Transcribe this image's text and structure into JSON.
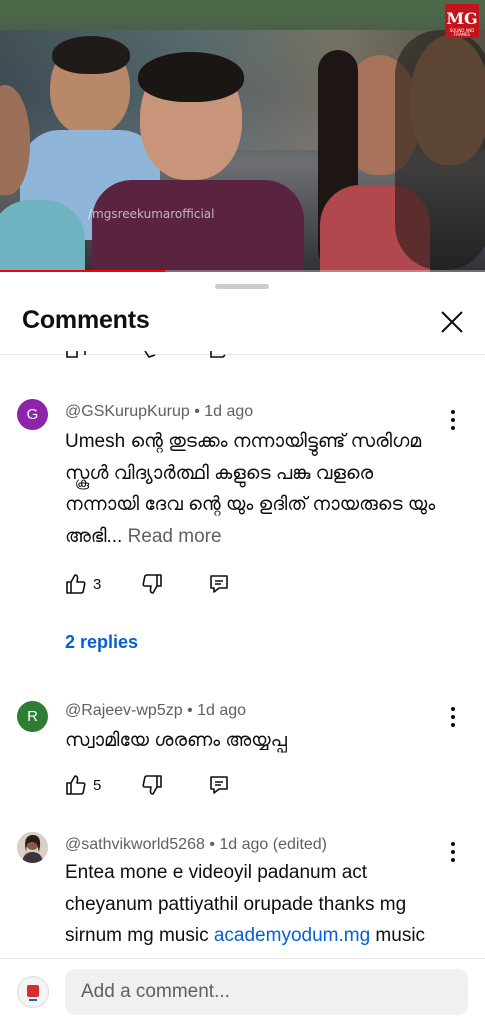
{
  "video": {
    "watermark": "/mgsreekumarofficial",
    "logo": "MG",
    "logo_tag": "SOUND AND FRAMES",
    "progress_fraction": 0.34
  },
  "sheet": {
    "title": "Comments"
  },
  "comments": [
    {
      "avatar_letter": "G",
      "avatar_color": "#8e24aa",
      "author": "@GSKurupKurup",
      "time": "1d ago",
      "text": "Umesh ന്റെ തുടക്കം നന്നായിട്ടുണ്ട് സരിഗമ സ്കൂൾ വിദ്യാർത്ഥി കളുടെ പങ്കു വളരെ നന്നായി ദേവ ന്റെ യും ഉദിത് നായരുടെ യും അഭി...",
      "read_more": "Read more",
      "likes": "3",
      "replies": "2 replies"
    },
    {
      "avatar_letter": "R",
      "avatar_color": "#2e7d32",
      "author": "@Rajeev-wp5zp",
      "time": "1d ago",
      "text": "സ്വാമിയേ ശരണം അയ്യപ്പ",
      "likes": "5"
    },
    {
      "author": "@sathvikworld5268",
      "time": "1d ago (edited)",
      "text_before": "Entea mone e videoyil padanum act cheyanum pattiyathil orupade thanks mg sirnum mg music ",
      "link": "academyodum.mg",
      "text_after": " music"
    }
  ],
  "footer": {
    "placeholder": "Add a comment..."
  }
}
